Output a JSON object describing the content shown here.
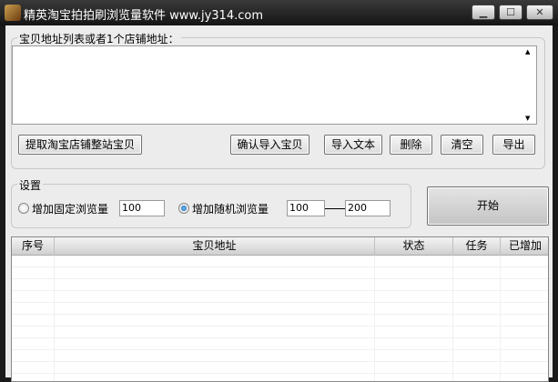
{
  "window": {
    "title": "精英淘宝拍拍刷浏览量软件 www.jy314.com",
    "minimize": "▁",
    "maximize": "☐",
    "close": "✕"
  },
  "address_group": {
    "label": "宝贝地址列表或者1个店铺地址：",
    "textarea_value": "",
    "buttons": {
      "extract": "提取淘宝店铺整站宝贝",
      "confirm_import": "确认导入宝贝",
      "import_text": "导入文本",
      "delete": "删除",
      "clear": "清空",
      "export": "导出"
    }
  },
  "settings": {
    "label": "设置",
    "fixed_label": "增加固定浏览量",
    "fixed_value": "100",
    "fixed_selected": false,
    "random_label": "增加随机浏览量",
    "random_min": "100",
    "random_max": "200",
    "random_selected": true
  },
  "start_button": "开始",
  "table": {
    "columns": [
      "序号",
      "宝贝地址",
      "状态",
      "任务",
      "已增加"
    ],
    "rows": []
  }
}
